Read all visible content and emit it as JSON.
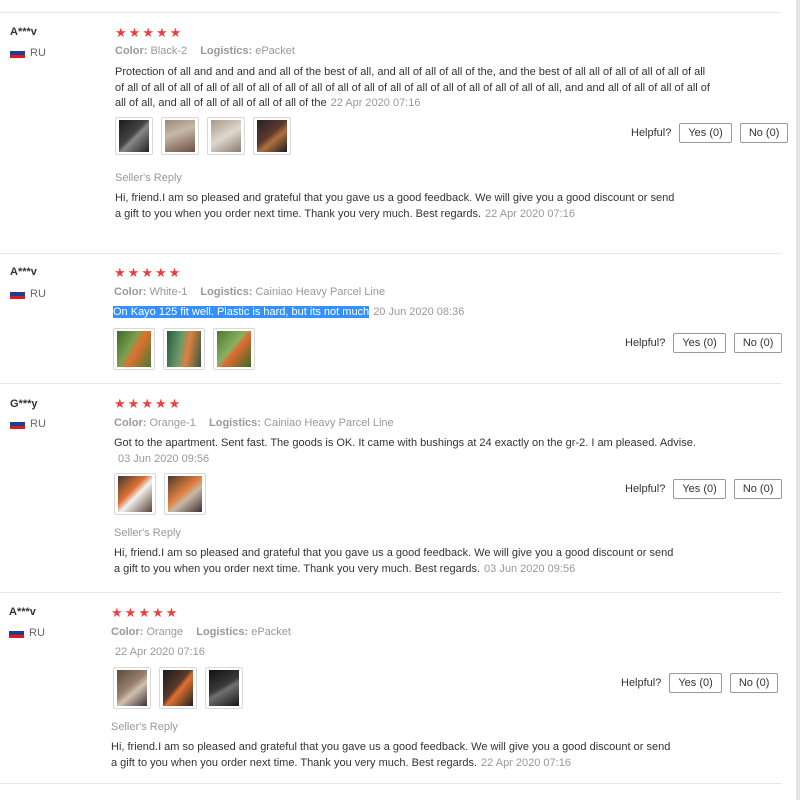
{
  "common": {
    "helpful_label": "Helpful?",
    "seller_reply_label": "Seller's Reply",
    "color_label": "Color:",
    "logistics_label": "Logistics:",
    "star_glyph": "★",
    "flag_colors": [
      "#ffffff",
      "#1c3f94",
      "#e4181c"
    ]
  },
  "reviews": [
    {
      "user": "A***v",
      "country": "RU",
      "rating": 5,
      "color": "Black-2",
      "logistics": "ePacket",
      "text": "Protection of all and and and and all of the best of all, and all of all of all of the, and the best of all all of all of all of all of all of all of all of all of all of all of all of all of all of all of all of all of all of all of all of all of all of all, and and all of all of all of all of all of all, and all of all of all of all of all of the",
      "date": "22 Apr 2020 07:16",
      "yes": "Yes (0)",
      "no": "No (0)",
      "reply_text": "Hi, friend.I am so pleased and grateful that you gave us a good feedback. We will give you a good discount or send a gift to you when you order next time. Thank you very much. Best regards.",
      "reply_date": "22 Apr 2020 07:16"
    },
    {
      "user": "A***v",
      "country": "RU",
      "rating": 5,
      "color": "White-1",
      "logistics": "Cainiao Heavy Parcel Line",
      "text": "On Kayo 125 fit well. Plastic is hard, but its not much",
      "date": "20 Jun 2020 08:36",
      "yes": "Yes (0)",
      "no": "No (0)"
    },
    {
      "user": "G***y",
      "country": "RU",
      "rating": 5,
      "color": "Orange-1",
      "logistics": "Cainiao Heavy Parcel Line",
      "text": "Got to the apartment. Sent fast. The goods is OK. It came with bushings at 24 exactly on the gr-2. I am pleased. Advise.",
      "date": "03 Jun 2020 09:56",
      "yes": "Yes (0)",
      "no": "No (0)",
      "reply_text": "Hi, friend.I am so pleased and grateful that you gave us a good feedback. We will give you a good discount or send a gift to you when you order next time. Thank you very much. Best regards.",
      "reply_date": "03 Jun 2020 09:56"
    },
    {
      "user": "A***v",
      "country": "RU",
      "rating": 5,
      "color": "Orange",
      "logistics": "ePacket",
      "text": "",
      "date": "22 Apr 2020 07:16",
      "yes": "Yes (0)",
      "no": "No (0)",
      "reply_text": "Hi, friend.I am so pleased and grateful that you gave us a good feedback. We will give you a good discount or send a gift to you when you order next time. Thank you very much. Best regards.",
      "reply_date": "22 Apr 2020 07:16"
    }
  ]
}
